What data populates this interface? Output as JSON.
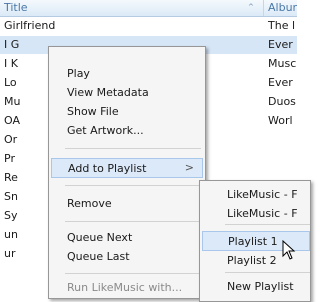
{
  "header": {
    "title": "Title",
    "album": "Albur"
  },
  "rows": [
    {
      "title": "Girlfriend",
      "album": "The l"
    },
    {
      "title": "I G",
      "album": "Ever"
    },
    {
      "title": "I K",
      "album": "Musc"
    },
    {
      "title": "Lo",
      "album": "Ever"
    },
    {
      "title": "Mu",
      "album": "Duos"
    },
    {
      "title": "OA",
      "album": "Worl"
    },
    {
      "title": "Or",
      "album": ""
    },
    {
      "title": "Pr",
      "album": ""
    },
    {
      "title": "Re",
      "album": ""
    },
    {
      "title": "Sn",
      "album": ""
    },
    {
      "title": "Sy",
      "album": ""
    },
    {
      "title": "un",
      "album": ""
    },
    {
      "title": "ur",
      "album": ""
    }
  ],
  "context_menu": {
    "play": "Play",
    "view_metadata": "View Metadata",
    "show_file": "Show File",
    "get_artwork": "Get Artwork...",
    "add_to_playlist": "Add to Playlist",
    "remove": "Remove",
    "queue_next": "Queue Next",
    "queue_last": "Queue Last",
    "run_with": "Run LikeMusic with..."
  },
  "submenu": {
    "item1": "LikeMusic - F",
    "item2": "LikeMusic - F",
    "playlist1": "Playlist 1",
    "playlist2": "Playlist 2",
    "new_playlist": "New Playlist"
  }
}
